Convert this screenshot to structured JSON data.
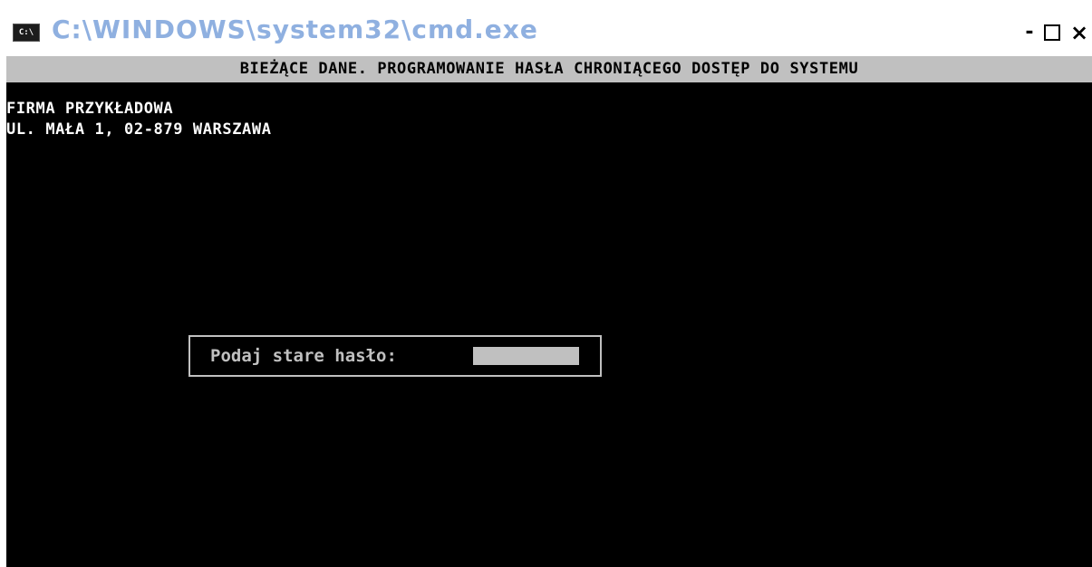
{
  "window": {
    "title": "C:\\WINDOWS\\system32\\cmd.exe",
    "icon": "cmd-app-icon",
    "icon_text": "C:\\",
    "controls": {
      "minimize_label": "-",
      "close_label": "×"
    }
  },
  "console": {
    "header": "BIEŻĄCE DANE. PROGRAMOWANIE HASŁA CHRONIĄCEGO DOSTĘP DO SYSTEMU",
    "company_name": "FIRMA PRZYKŁADOWA",
    "company_address": "UL. MAŁA 1, 02-879 WARSZAWA"
  },
  "dialog": {
    "prompt": "Podaj stare hasło:",
    "password_value": ""
  },
  "colors": {
    "console_background": "#000000",
    "console_text": "#ffffff",
    "header_bar": "#c0c0c0",
    "title_text": "#8fb0e0"
  }
}
